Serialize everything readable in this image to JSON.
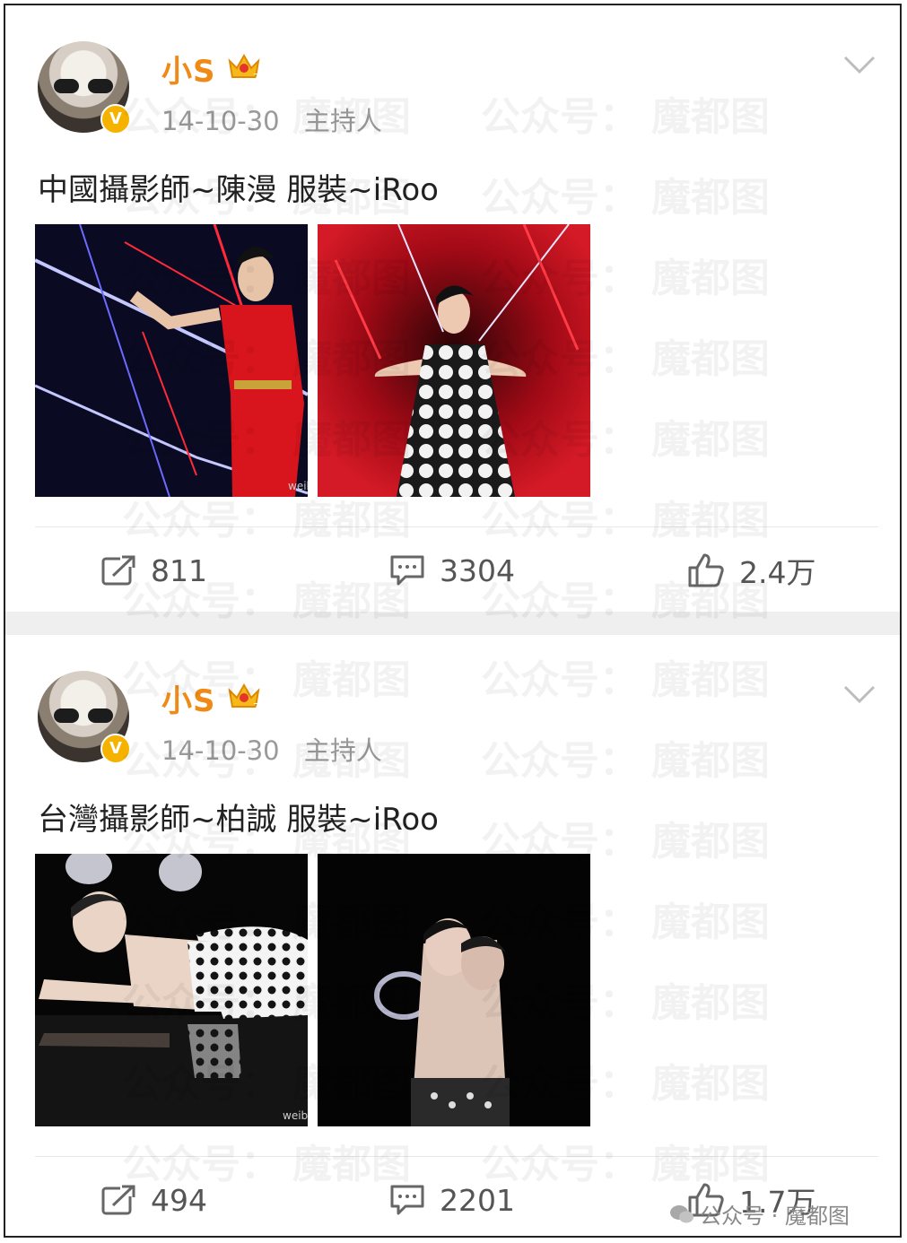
{
  "posts": [
    {
      "username": "小S",
      "date": "14-10-30",
      "role": "主持人",
      "text": "中國攝影師~陳漫 服裝~iRoo",
      "reposts": "811",
      "comments": "3304",
      "likes": "2.4万",
      "img_watermark": "weib"
    },
    {
      "username": "小S",
      "date": "14-10-30",
      "role": "主持人",
      "text": "台灣攝影師~柏誠 服裝~iRoo",
      "reposts": "494",
      "comments": "2201",
      "likes": "1.7万",
      "img_watermark": "weib"
    }
  ],
  "watermark": {
    "a": "公众号：",
    "b": "魔都图"
  },
  "credit": "公众号 · 魔都图",
  "colors": {
    "username": "#f08a16",
    "badge": "#f5b300",
    "text": "#222222",
    "meta": "#9a9a9a",
    "separator": "#efefef"
  },
  "icons": [
    "repost-icon",
    "comment-icon",
    "like-icon",
    "chevron-down-icon",
    "crown-icon",
    "verified-icon"
  ]
}
